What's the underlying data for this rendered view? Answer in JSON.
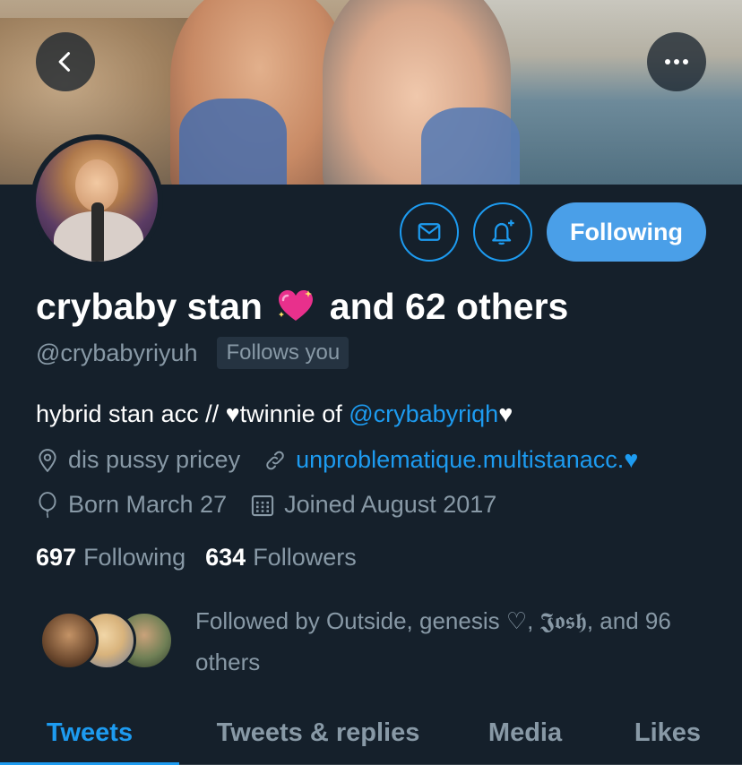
{
  "colors": {
    "background": "#15202b",
    "accent": "#1d9bf0",
    "follow_button": "#4a9fe8",
    "muted_text": "#8899a6",
    "badge_bg": "#253341"
  },
  "header": {
    "back_icon": "chevron-left-icon",
    "more_icon": "more-horizontal-icon"
  },
  "actions": {
    "message_icon": "mail-icon",
    "notify_icon": "bell-plus-icon",
    "follow_label": "Following"
  },
  "profile": {
    "name_part1": "crybaby stan",
    "name_emoji": "sparkling-heart",
    "name_part2": "and 62 others",
    "handle": "@crybabyriyuh",
    "follows_you": "Follows you",
    "bio_prefix": "hybrid stan acc // ",
    "bio_heart1": "♥",
    "bio_mid": "twinnie of ",
    "bio_mention": "@crybabyriqh",
    "bio_heart2": "♥",
    "location": "dis pussy pricey",
    "website": "unproblematique.multistanacc.",
    "website_heart": "♥",
    "birthday": "Born March 27",
    "joined": "Joined August 2017"
  },
  "counts": {
    "following_num": "697",
    "following_label": "Following",
    "followers_num": "634",
    "followers_label": "Followers"
  },
  "followed_by": {
    "text": "Followed by Outside, genesis ♡, 𝕵𝖔𝖘𝖍, and 96 others"
  },
  "tabs": [
    {
      "label": "Tweets"
    },
    {
      "label": "Tweets & replies"
    },
    {
      "label": "Media"
    },
    {
      "label": "Likes"
    }
  ]
}
